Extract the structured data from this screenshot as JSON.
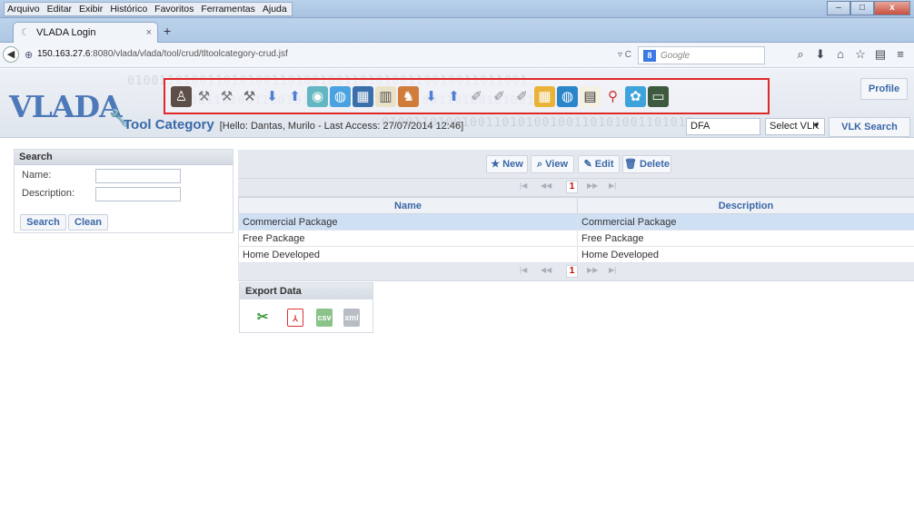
{
  "menu": [
    "Arquivo",
    "Editar",
    "Exibir",
    "Histórico",
    "Favoritos",
    "Ferramentas",
    "Ajuda"
  ],
  "window": {
    "minimize": "–",
    "maximize": "□",
    "close": "x"
  },
  "tab": {
    "title": "VLADA Login",
    "close": "×",
    "new": "+"
  },
  "address": {
    "host": "150.163.27.6",
    "path": ":8080/vlada/vlada/tool/crud/tltoolcategory-crud.jsf"
  },
  "search_engine": {
    "badge": "8",
    "placeholder": "Google"
  },
  "app": {
    "logo": "VLADA",
    "page_title": "Tool Category",
    "greeting": "[Hello: Dantas, Murilo - Last Access: 27/07/2014 12:46]",
    "profile_label": "Profile",
    "search_value": "DFA",
    "select_vlk": "Select VLK",
    "vlk_search_label": "VLK Search"
  },
  "search_panel": {
    "title": "Search",
    "name_label": "Name:",
    "description_label": "Description:",
    "search_button": "Search",
    "clean_button": "Clean"
  },
  "actions": {
    "new": "New",
    "view": "View",
    "edit": "Edit",
    "delete": "Delete"
  },
  "paginator": {
    "current": "1"
  },
  "table": {
    "columns": [
      "Name",
      "Description"
    ],
    "rows": [
      [
        "Commercial Package",
        "Commercial Package"
      ],
      [
        "Free Package",
        "Free Package"
      ],
      [
        "Home Developed",
        "Home Developed"
      ]
    ]
  },
  "export": {
    "title": "Export Data"
  }
}
